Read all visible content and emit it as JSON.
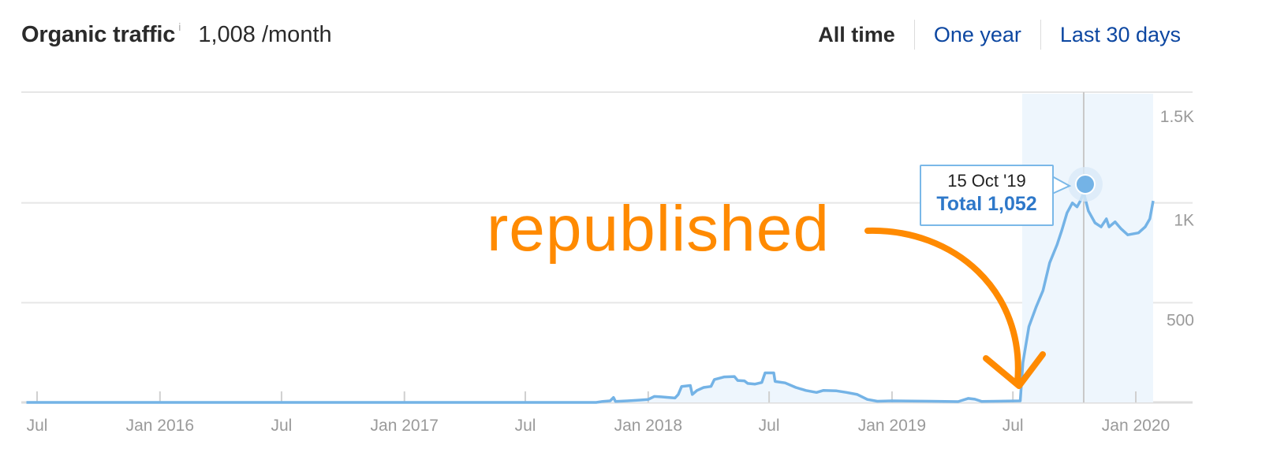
{
  "header": {
    "title": "Organic traffic",
    "info_marker": "i",
    "metric_value": "1,008 /month"
  },
  "range_selector": {
    "options": [
      {
        "label": "All time",
        "active": true
      },
      {
        "label": "One year",
        "active": false
      },
      {
        "label": "Last 30 days",
        "active": false
      }
    ]
  },
  "tooltip": {
    "date": "15 Oct '19",
    "total_label": "Total 1,052"
  },
  "annotation": {
    "text": "republished",
    "color": "#ff8a00"
  },
  "colors": {
    "line": "#74b3e6",
    "area": "#eef6fd",
    "grid": "#e6e6e6",
    "crosshair": "#c8c8c8",
    "link": "#0d47a1"
  },
  "chart_data": {
    "type": "area",
    "title": "Organic traffic",
    "xlabel": "",
    "ylabel": "",
    "x_range": [
      "2015-06-15",
      "2020-03-15"
    ],
    "ylim": [
      0,
      1500
    ],
    "grid": true,
    "y_ticks": [
      {
        "value": 500,
        "label": "500"
      },
      {
        "value": 1000,
        "label": "1K"
      },
      {
        "value": 1500,
        "label": "1.5K"
      }
    ],
    "x_ticks": [
      {
        "date": "2015-07-01",
        "label": "Jul"
      },
      {
        "date": "2016-01-01",
        "label": "Jan 2016"
      },
      {
        "date": "2016-07-01",
        "label": "Jul"
      },
      {
        "date": "2017-01-01",
        "label": "Jan 2017"
      },
      {
        "date": "2017-07-01",
        "label": "Jul"
      },
      {
        "date": "2018-01-01",
        "label": "Jan 2018"
      },
      {
        "date": "2018-07-01",
        "label": "Jul"
      },
      {
        "date": "2019-01-01",
        "label": "Jan 2019"
      },
      {
        "date": "2019-07-01",
        "label": "Jul"
      },
      {
        "date": "2020-01-01",
        "label": "Jan 2020"
      }
    ],
    "highlight": {
      "date": "2019-10-15",
      "value": 1052
    },
    "shaded_from": "2019-07-15",
    "series": [
      {
        "name": "Organic traffic",
        "points": [
          [
            "2015-06-15",
            0
          ],
          [
            "2017-10-15",
            0
          ],
          [
            "2017-10-25",
            5
          ],
          [
            "2017-11-05",
            8
          ],
          [
            "2017-11-10",
            25
          ],
          [
            "2017-11-13",
            5
          ],
          [
            "2017-12-01",
            8
          ],
          [
            "2017-12-20",
            12
          ],
          [
            "2018-01-01",
            15
          ],
          [
            "2018-01-10",
            30
          ],
          [
            "2018-01-20",
            28
          ],
          [
            "2018-02-10",
            22
          ],
          [
            "2018-02-15",
            40
          ],
          [
            "2018-02-20",
            80
          ],
          [
            "2018-03-05",
            85
          ],
          [
            "2018-03-08",
            40
          ],
          [
            "2018-03-15",
            60
          ],
          [
            "2018-03-25",
            75
          ],
          [
            "2018-04-05",
            80
          ],
          [
            "2018-04-10",
            115
          ],
          [
            "2018-04-25",
            128
          ],
          [
            "2018-05-10",
            130
          ],
          [
            "2018-05-15",
            110
          ],
          [
            "2018-05-25",
            108
          ],
          [
            "2018-05-30",
            95
          ],
          [
            "2018-06-10",
            92
          ],
          [
            "2018-06-20",
            100
          ],
          [
            "2018-06-25",
            148
          ],
          [
            "2018-07-08",
            148
          ],
          [
            "2018-07-10",
            105
          ],
          [
            "2018-07-25",
            98
          ],
          [
            "2018-08-10",
            75
          ],
          [
            "2018-08-25",
            60
          ],
          [
            "2018-09-10",
            50
          ],
          [
            "2018-09-20",
            60
          ],
          [
            "2018-10-10",
            58
          ],
          [
            "2018-10-25",
            50
          ],
          [
            "2018-11-10",
            40
          ],
          [
            "2018-11-25",
            15
          ],
          [
            "2018-12-10",
            6
          ],
          [
            "2019-01-01",
            8
          ],
          [
            "2019-03-01",
            6
          ],
          [
            "2019-04-10",
            4
          ],
          [
            "2019-04-25",
            20
          ],
          [
            "2019-05-05",
            16
          ],
          [
            "2019-05-15",
            5
          ],
          [
            "2019-07-12",
            8
          ],
          [
            "2019-07-16",
            200
          ],
          [
            "2019-07-25",
            380
          ],
          [
            "2019-08-05",
            480
          ],
          [
            "2019-08-15",
            560
          ],
          [
            "2019-08-25",
            700
          ],
          [
            "2019-09-05",
            790
          ],
          [
            "2019-09-12",
            860
          ],
          [
            "2019-09-20",
            950
          ],
          [
            "2019-09-28",
            1000
          ],
          [
            "2019-10-05",
            980
          ],
          [
            "2019-10-10",
            1010
          ],
          [
            "2019-10-15",
            1052
          ],
          [
            "2019-10-22",
            960
          ],
          [
            "2019-11-01",
            900
          ],
          [
            "2019-11-10",
            880
          ],
          [
            "2019-11-18",
            920
          ],
          [
            "2019-11-22",
            880
          ],
          [
            "2019-12-01",
            905
          ],
          [
            "2019-12-10",
            870
          ],
          [
            "2019-12-20",
            840
          ],
          [
            "2020-01-05",
            850
          ],
          [
            "2020-01-15",
            880
          ],
          [
            "2020-01-22",
            920
          ],
          [
            "2020-01-27",
            1010
          ]
        ]
      }
    ]
  }
}
